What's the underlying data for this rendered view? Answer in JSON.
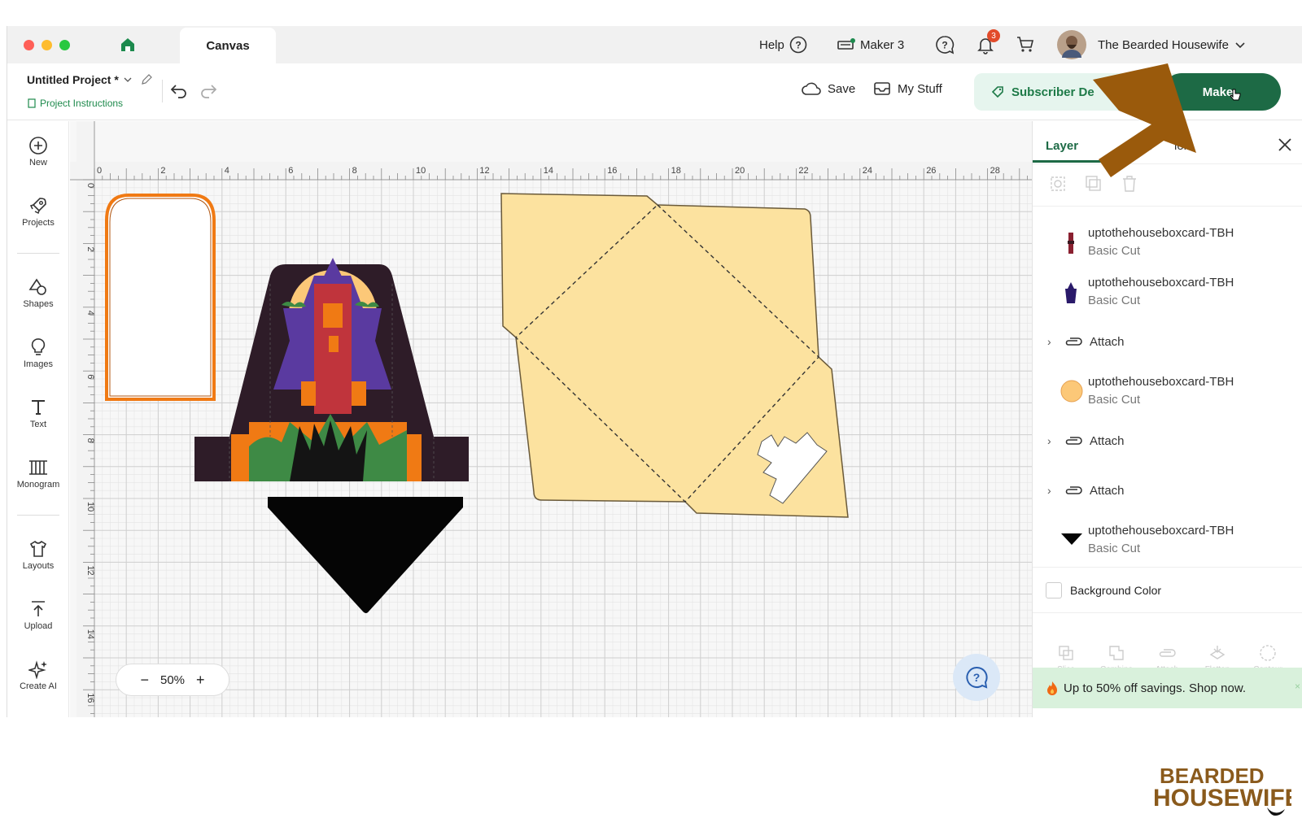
{
  "titlebar": {
    "tab_label": "Canvas",
    "help_label": "Help",
    "machine_label": "Maker 3",
    "notification_count": "3",
    "user_name": "The Bearded Housewife"
  },
  "toolbar": {
    "project_title": "Untitled Project *",
    "project_instructions": "Project Instructions",
    "save_label": "Save",
    "mystuff_label": "My Stuff",
    "subscriber_label": "Subscriber De",
    "make_label": "Make"
  },
  "sidebar": {
    "items": [
      {
        "label": "New",
        "icon": "plus-circle-icon"
      },
      {
        "label": "Projects",
        "icon": "rocket-icon"
      },
      {
        "label": "Shapes",
        "icon": "shapes-icon"
      },
      {
        "label": "Images",
        "icon": "lightbulb-icon"
      },
      {
        "label": "Text",
        "icon": "text-icon"
      },
      {
        "label": "Monogram",
        "icon": "monogram-icon"
      },
      {
        "label": "Layouts",
        "icon": "shirt-icon"
      },
      {
        "label": "Upload",
        "icon": "upload-icon"
      },
      {
        "label": "Create AI",
        "icon": "sparkle-icon"
      }
    ]
  },
  "canvas": {
    "ruler_x": [
      "0",
      "2",
      "4",
      "6",
      "8",
      "10",
      "12",
      "14",
      "16",
      "18",
      "20",
      "22",
      "24",
      "26",
      "28"
    ],
    "ruler_y": [
      "0",
      "2",
      "4",
      "6",
      "8",
      "10",
      "12",
      "14",
      "16"
    ],
    "zoom_label": "50%"
  },
  "panel": {
    "tab_layers": "Layer",
    "tab_materials": "teri",
    "tab_colors": "lors",
    "layers": [
      {
        "name": "uptothehouseboxcard-TBH",
        "op": "Basic Cut"
      },
      {
        "name": "uptothehouseboxcard-TBH",
        "op": "Basic Cut"
      },
      {
        "name": "uptothehouseboxcard-TBH",
        "op": "Basic Cut"
      },
      {
        "name": "uptothehouseboxcard-TBH",
        "op": "Basic Cut"
      }
    ],
    "attach_label": "Attach",
    "background_label": "Background Color",
    "bottom_tools": [
      "Slice",
      "Combine",
      "Attach",
      "Flatten",
      "Contour"
    ],
    "promo": "Up to 50% off savings. Shop now."
  },
  "colors": {
    "accent_green": "#1d6a45",
    "arrow": "#9a5a0c",
    "envelope": "#fce29f",
    "orange": "#f07a14",
    "purple": "#2e1c28"
  }
}
